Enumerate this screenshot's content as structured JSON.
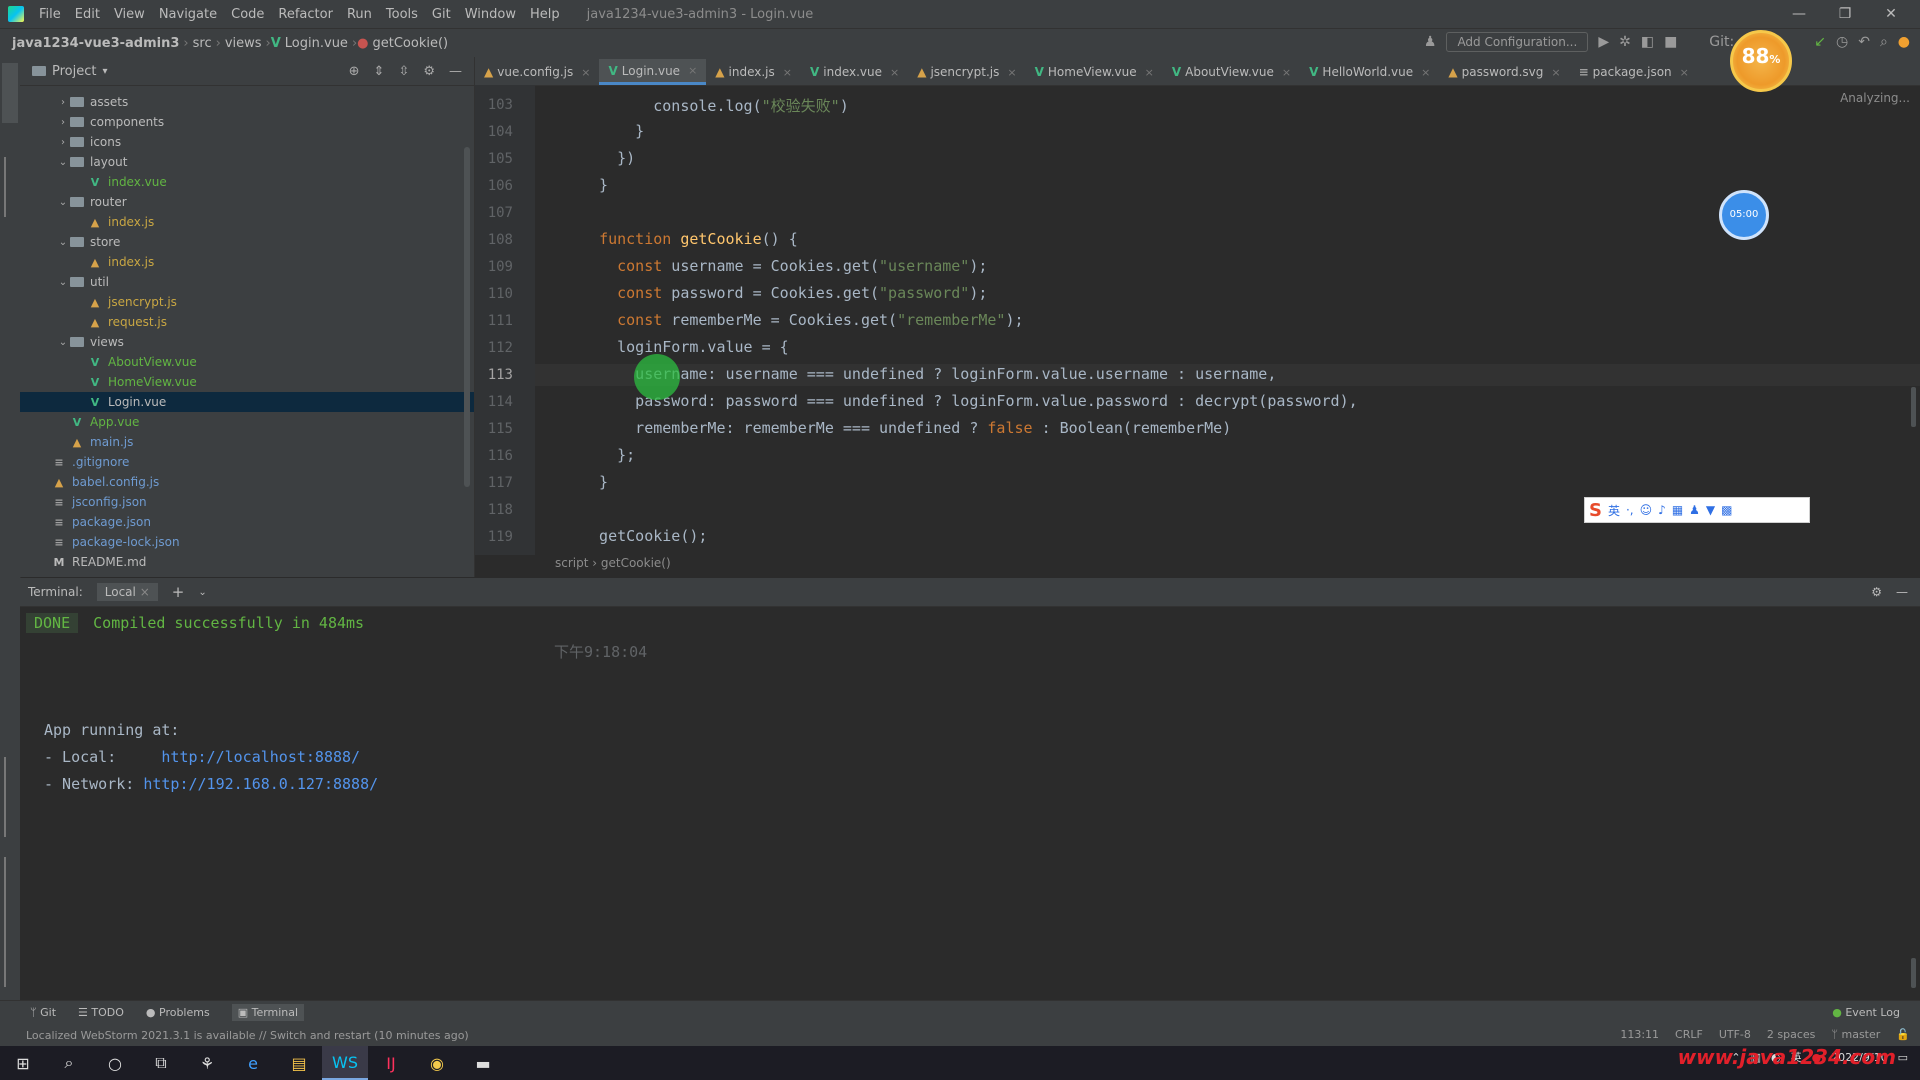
{
  "app": {
    "menu": [
      "File",
      "Edit",
      "View",
      "Navigate",
      "Code",
      "Refactor",
      "Run",
      "Tools",
      "Git",
      "Window",
      "Help"
    ],
    "window_title": "java1234-vue3-admin3 - Login.vue",
    "window_controls": [
      "—",
      "❐",
      "✕"
    ]
  },
  "navbar": {
    "crumbs": [
      "java1234-vue3-admin3",
      "src",
      "views",
      "Login.vue",
      "getCookie()"
    ],
    "add_config": "Add Configuration...",
    "git_label": "Git:"
  },
  "project": {
    "title": "Project",
    "tree": [
      {
        "indent": 2,
        "arrow": "›",
        "kind": "folder",
        "name": "assets"
      },
      {
        "indent": 2,
        "arrow": "›",
        "kind": "folder",
        "name": "components"
      },
      {
        "indent": 2,
        "arrow": "›",
        "kind": "folder",
        "name": "icons"
      },
      {
        "indent": 2,
        "arrow": "⌄",
        "kind": "folder",
        "name": "layout"
      },
      {
        "indent": 3,
        "arrow": "",
        "kind": "vue",
        "name": "index.vue"
      },
      {
        "indent": 2,
        "arrow": "⌄",
        "kind": "folder",
        "name": "router"
      },
      {
        "indent": 3,
        "arrow": "",
        "kind": "js",
        "name": "index.js"
      },
      {
        "indent": 2,
        "arrow": "⌄",
        "kind": "folder",
        "name": "store"
      },
      {
        "indent": 3,
        "arrow": "",
        "kind": "js",
        "name": "index.js"
      },
      {
        "indent": 2,
        "arrow": "⌄",
        "kind": "folder",
        "name": "util"
      },
      {
        "indent": 3,
        "arrow": "",
        "kind": "js",
        "name": "jsencrypt.js"
      },
      {
        "indent": 3,
        "arrow": "",
        "kind": "js",
        "name": "request.js"
      },
      {
        "indent": 2,
        "arrow": "⌄",
        "kind": "folder",
        "name": "views"
      },
      {
        "indent": 3,
        "arrow": "",
        "kind": "vue",
        "name": "AboutView.vue"
      },
      {
        "indent": 3,
        "arrow": "",
        "kind": "vue",
        "name": "HomeView.vue"
      },
      {
        "indent": 3,
        "arrow": "",
        "kind": "vue",
        "name": "Login.vue",
        "selected": true
      },
      {
        "indent": 2,
        "arrow": "",
        "kind": "vue",
        "name": "App.vue"
      },
      {
        "indent": 2,
        "arrow": "",
        "kind": "js",
        "name": "main.js"
      },
      {
        "indent": 1,
        "arrow": "",
        "kind": "json",
        "name": ".gitignore"
      },
      {
        "indent": 1,
        "arrow": "",
        "kind": "js",
        "name": "babel.config.js"
      },
      {
        "indent": 1,
        "arrow": "",
        "kind": "json",
        "name": "jsconfig.json"
      },
      {
        "indent": 1,
        "arrow": "",
        "kind": "json",
        "name": "package.json"
      },
      {
        "indent": 1,
        "arrow": "",
        "kind": "json",
        "name": "package-lock.json"
      },
      {
        "indent": 1,
        "arrow": "",
        "kind": "md",
        "name": "README.md"
      }
    ]
  },
  "editor": {
    "tabs": [
      {
        "icon": "js",
        "label": "vue.config.js"
      },
      {
        "icon": "vue",
        "label": "Login.vue",
        "active": true
      },
      {
        "icon": "js",
        "label": "index.js"
      },
      {
        "icon": "vue",
        "label": "index.vue"
      },
      {
        "icon": "js",
        "label": "jsencrypt.js"
      },
      {
        "icon": "vue",
        "label": "HomeView.vue"
      },
      {
        "icon": "vue",
        "label": "AboutView.vue"
      },
      {
        "icon": "vue",
        "label": "HelloWorld.vue"
      },
      {
        "icon": "js",
        "label": "password.svg"
      },
      {
        "icon": "json",
        "label": "package.json"
      }
    ],
    "analyzing": "Analyzing...",
    "breadcrumb": "script  ›  getCookie()",
    "lines": [
      {
        "n": "103",
        "html": "        console.log(<span class=\"str\">\"校验失败\"</span>)"
      },
      {
        "n": "104",
        "html": "      }"
      },
      {
        "n": "105",
        "html": "    })"
      },
      {
        "n": "106",
        "html": "  }"
      },
      {
        "n": "107",
        "html": ""
      },
      {
        "n": "108",
        "html": "  <span class=\"kw\">function</span> <span class=\"fn\">getCookie</span>() {"
      },
      {
        "n": "109",
        "html": "    <span class=\"kw\">const</span> username = Cookies.get(<span class=\"str\">\"username\"</span>);"
      },
      {
        "n": "110",
        "html": "    <span class=\"kw\">const</span> password = Cookies.get(<span class=\"str\">\"password\"</span>);"
      },
      {
        "n": "111",
        "html": "    <span class=\"kw\">const</span> rememberMe = Cookies.get(<span class=\"str\">\"rememberMe\"</span>);"
      },
      {
        "n": "112",
        "html": "    loginForm.value = {"
      },
      {
        "n": "113",
        "html": "      username: username === undefined ? loginForm.value.username : username,",
        "current": true
      },
      {
        "n": "114",
        "html": "      password: password === undefined ? loginForm.value.password : decrypt(password),"
      },
      {
        "n": "115",
        "html": "      rememberMe: rememberMe === undefined ? <span class=\"kw\">false</span> : Boolean(rememberMe)"
      },
      {
        "n": "116",
        "html": "    };"
      },
      {
        "n": "117",
        "html": "  }"
      },
      {
        "n": "118",
        "html": ""
      },
      {
        "n": "119",
        "html": "  getCookie();"
      }
    ]
  },
  "terminal": {
    "title": "Terminal:",
    "tab": "Local",
    "done": "DONE",
    "compiled": "Compiled successfully in 484ms",
    "time": "下午9:18:04",
    "running": "App running at:",
    "local_label": "- Local:   ",
    "local_url": "http://localhost:8888/",
    "network_label": "- Network: ",
    "network_url": "http://192.168.0.127:8888/"
  },
  "bottom_tools": [
    "Git",
    "TODO",
    "Problems",
    "Terminal"
  ],
  "event_log": "Event Log",
  "status": {
    "message": "Localized WebStorm 2021.3.1 is available // Switch and restart (10 minutes ago)",
    "right": [
      "113:11",
      "CRLF",
      "UTF-8",
      "2 spaces",
      "master"
    ]
  },
  "overlays": {
    "cpu_value": "88",
    "cpu_unit": "%",
    "bubble": "05:00"
  },
  "taskbar": {
    "date": "2022/9/10"
  },
  "watermark": "www.java1234.com"
}
